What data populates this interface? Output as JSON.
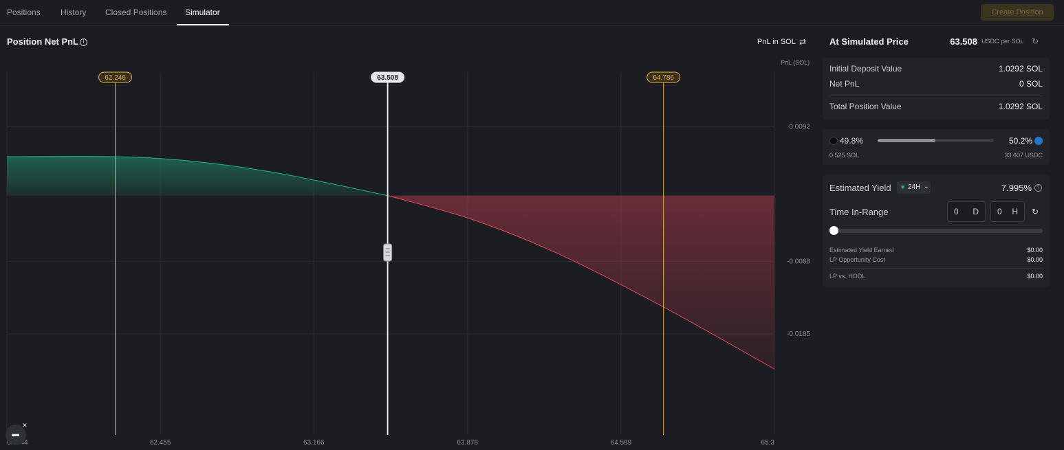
{
  "tabs": [
    {
      "label": "Positions"
    },
    {
      "label": "History"
    },
    {
      "label": "Closed Positions"
    },
    {
      "label": "Simulator"
    }
  ],
  "create_position_label": "Create Position",
  "chart_panel": {
    "title": "Position Net PnL",
    "pnl_toggle": "PnL in SOL",
    "axis_unit": "PnL (SOL)"
  },
  "chart_data": {
    "type": "area",
    "x_ticks": [
      "61.744",
      "62.455",
      "63.166",
      "63.878",
      "64.589",
      "65.3"
    ],
    "y_ticks": [
      "0.0092",
      "-0.0088",
      "-0.0185"
    ],
    "xlim": [
      61.744,
      65.3
    ],
    "ylim": [
      -0.032,
      0.0165
    ],
    "x": [
      61.744,
      62.246,
      62.6,
      63.0,
      63.508,
      63.9,
      64.3,
      64.786,
      65.3
    ],
    "y": [
      0.0052,
      0.0052,
      0.0046,
      0.003,
      0.0,
      -0.0032,
      -0.0078,
      -0.0149,
      -0.0232
    ],
    "baseline": 0.0,
    "markers": {
      "lower_bound": "62.246",
      "current": "63.508",
      "upper_bound": "64.786"
    },
    "colors": {
      "profit": "#24b388",
      "loss": "#e5475b",
      "bounds": "#e5b23a",
      "current": "#e6e6ea"
    }
  },
  "simulated": {
    "label": "At Simulated Price",
    "price": "63.508",
    "unit": "USDC per SOL"
  },
  "summary": {
    "initial_deposit_label": "Initial Deposit Value",
    "initial_deposit_value": "1.0292 SOL",
    "net_pnl_label": "Net PnL",
    "net_pnl_value": "0 SOL",
    "total_label": "Total Position Value",
    "total_value": "1.0292 SOL"
  },
  "allocation": {
    "left_pct": "49.8%",
    "right_pct": "50.2%",
    "left_fraction": 0.498,
    "left_amount": "0.525 SOL",
    "right_amount": "33.607 USDC"
  },
  "yield": {
    "label": "Estimated Yield",
    "period": "24H",
    "value": "7.995%",
    "time_in_range_label": "Time In-Range",
    "days_value": "0",
    "days_unit": "D",
    "hours_value": "0",
    "hours_unit": "H",
    "slider_fraction": 0,
    "earned_label": "Estimated Yield Earned",
    "earned_value": "$0.00",
    "opportunity_label": "LP Opportunity Cost",
    "opportunity_value": "$0.00",
    "lp_hodl_label": "LP vs. HODL",
    "lp_hodl_value": "$0.00"
  }
}
